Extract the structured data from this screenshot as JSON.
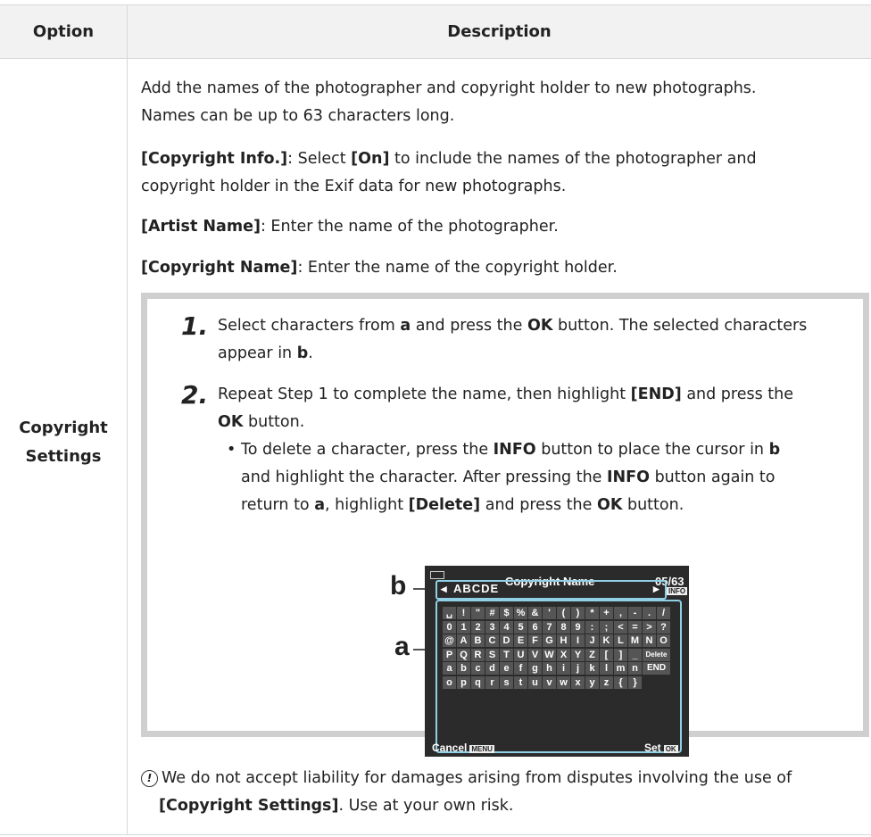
{
  "header": {
    "option": "Option",
    "description": "Description"
  },
  "option_name_line1": "Copyright",
  "option_name_line2": "Settings",
  "intro": {
    "line1": "Add the names of the photographer and copyright holder to new photographs.",
    "line2": "Names can be up to 63 characters long."
  },
  "copyright_info": {
    "term": "[Copyright Info.]",
    "pre": ": Select ",
    "on": "[On]",
    "post1": " to include the names of the photographer and",
    "post2": "copyright holder in the Exif data for new photographs."
  },
  "artist": {
    "term": "[Artist Name]",
    "text": ": Enter the name of the photographer."
  },
  "cright": {
    "term": "[Copyright Name]",
    "text": ": Enter the name of the copyright holder."
  },
  "steps": [
    {
      "num": "1.",
      "l1_a": "Select characters from ",
      "l1_b": "a",
      "l1_c": " and press the ",
      "l1_d": "OK",
      "l1_e": " button. The selected characters",
      "l2_a": "appear in ",
      "l2_b": "b",
      "l2_c": "."
    },
    {
      "num": "2.",
      "l1_a": "Repeat Step 1 to complete the name, then highlight ",
      "l1_b": "[END]",
      "l1_c": " and press the",
      "l2_a": "OK",
      "l2_b": " button."
    }
  ],
  "bullet": {
    "l1_a": "To delete a character, press the ",
    "l1_b": "INFO",
    "l1_c": " button to place the cursor in ",
    "l1_d": "b",
    "l2_a": "and highlight the character. After pressing the ",
    "l2_b": "INFO",
    "l2_c": " button again to",
    "l3_a": "return to ",
    "l3_b": "a",
    "l3_c": ", highlight ",
    "l3_d": "[Delete]",
    "l3_e": " and press the ",
    "l3_f": "OK",
    "l3_g": " button."
  },
  "figure": {
    "label_b": "b",
    "label_a": "a",
    "title": "Copyright Name",
    "count": "05/63",
    "input_text": "ABCDE",
    "info_tag": "INFO",
    "rows": [
      [
        "␣",
        "!",
        "\"",
        "#",
        "$",
        "%",
        "&",
        "'",
        "(",
        ")",
        "*",
        "+",
        ",",
        "-",
        ".",
        "/"
      ],
      [
        "0",
        "1",
        "2",
        "3",
        "4",
        "5",
        "6",
        "7",
        "8",
        "9",
        ":",
        ";",
        "<",
        "=",
        ">",
        "?"
      ],
      [
        "@",
        "A",
        "B",
        "C",
        "D",
        "E",
        "F",
        "G",
        "H",
        "I",
        "J",
        "K",
        "L",
        "M",
        "N",
        "O"
      ],
      [
        "P",
        "Q",
        "R",
        "S",
        "T",
        "U",
        "V",
        "W",
        "X",
        "Y",
        "Z",
        "[",
        "]",
        "_",
        "Delete",
        ""
      ],
      [
        "a",
        "b",
        "c",
        "d",
        "e",
        "f",
        "g",
        "h",
        "i",
        "j",
        "k",
        "l",
        "m",
        "n",
        "END",
        ""
      ],
      [
        "o",
        "p",
        "q",
        "r",
        "s",
        "t",
        "u",
        "v",
        "w",
        "x",
        "y",
        "z",
        "{",
        "}",
        "",
        ""
      ]
    ],
    "cancel": "Cancel",
    "menu_tag": "MENU",
    "set": "Set",
    "ok_tag": "OK"
  },
  "note": {
    "icon": "!",
    "l1": "We do not accept liability for damages arising from disputes involving the use of",
    "l2_a": "[Copyright Settings]",
    "l2_b": ". Use at your own risk."
  }
}
